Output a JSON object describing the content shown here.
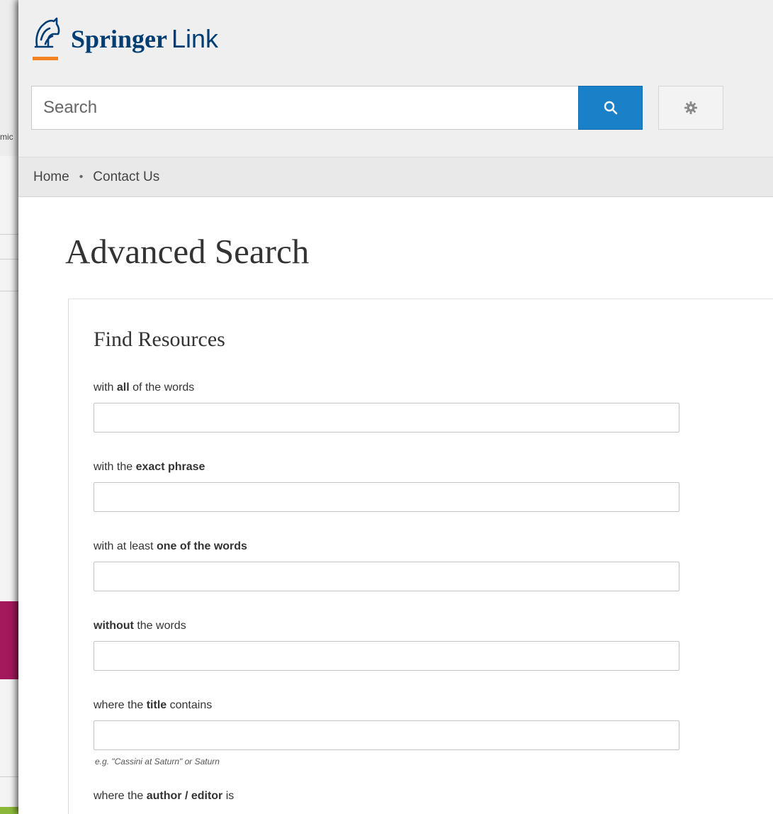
{
  "background": {
    "left_text": "mic"
  },
  "header": {
    "logo_brand": "Springer",
    "logo_product": "Link",
    "search_placeholder": "Search",
    "search_value": ""
  },
  "nav": {
    "items": [
      "Home",
      "Contact Us"
    ],
    "separator": "•"
  },
  "page": {
    "title": "Advanced Search"
  },
  "form": {
    "section_title": "Find Resources",
    "fields": [
      {
        "label_pre": "with ",
        "label_bold": "all",
        "label_post": " of the words",
        "value": ""
      },
      {
        "label_pre": "with the ",
        "label_bold": "exact phrase",
        "label_post": "",
        "value": ""
      },
      {
        "label_pre": "with at least ",
        "label_bold": "one of the words",
        "label_post": "",
        "value": ""
      },
      {
        "label_pre": "",
        "label_bold": "without",
        "label_post": " the words",
        "value": ""
      },
      {
        "label_pre": "where the ",
        "label_bold": "title",
        "label_post": " contains",
        "value": "",
        "hint": "e.g. \"Cassini at Saturn\" or Saturn"
      },
      {
        "label_pre": "where the ",
        "label_bold": "author / editor",
        "label_post": " is",
        "value": ""
      }
    ]
  },
  "colors": {
    "brand_blue": "#003d73",
    "logo_orange": "#f58220",
    "search_button": "#1a80c8"
  },
  "icons": {
    "logo": "springer-knight-icon",
    "search": "magnifier-icon",
    "settings": "gear-icon"
  }
}
